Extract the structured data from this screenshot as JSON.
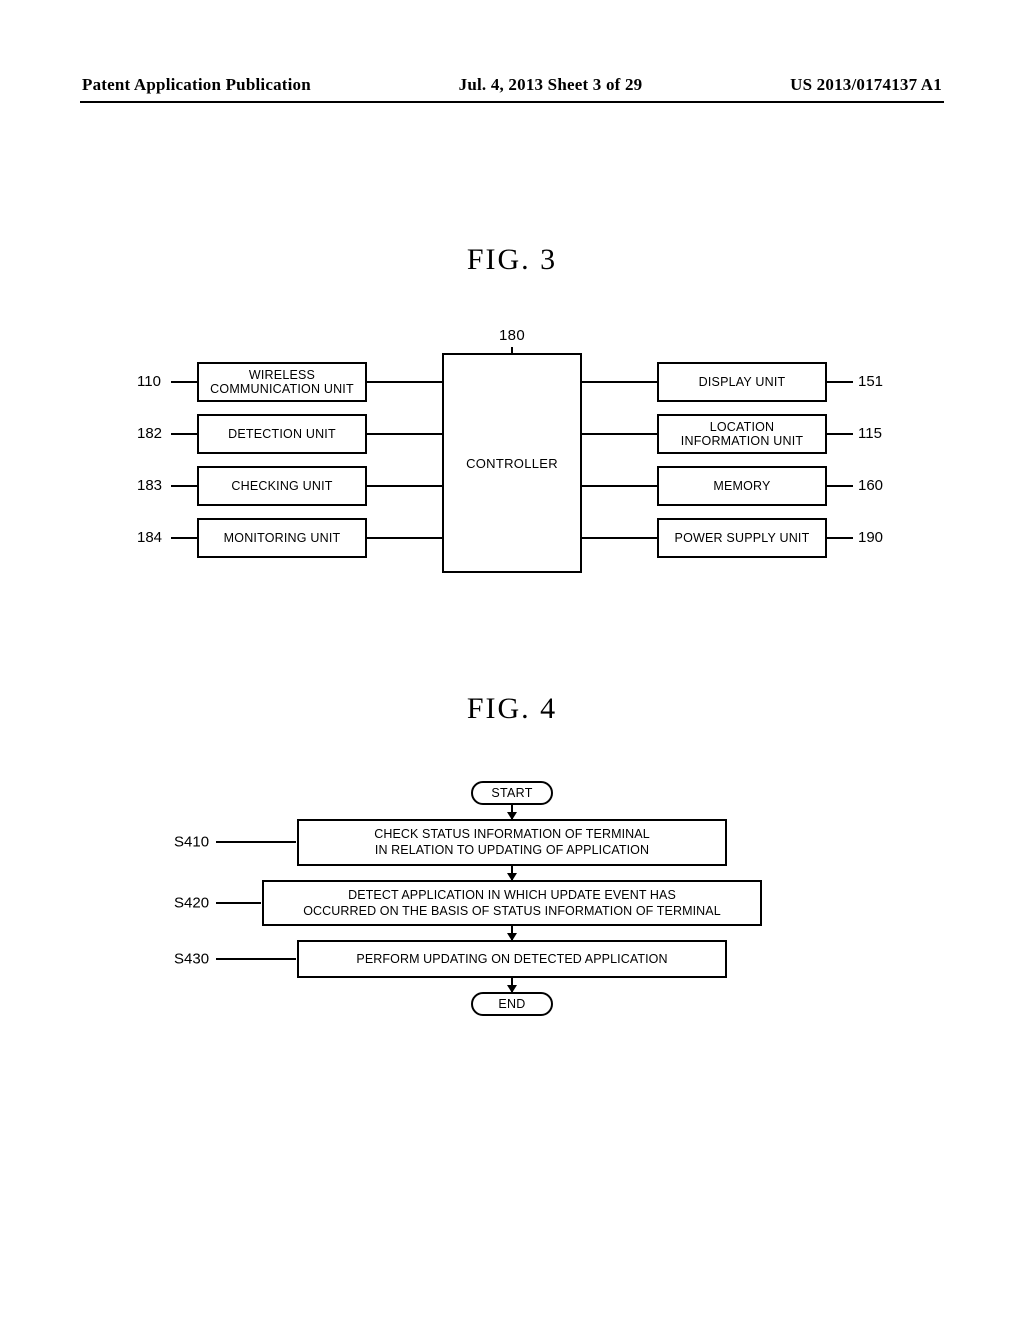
{
  "header": {
    "left": "Patent Application Publication",
    "mid": "Jul. 4, 2013  Sheet 3 of 29",
    "right": "US 2013/0174137 A1"
  },
  "fig3": {
    "title": "FIG. 3",
    "controller_ref": "180",
    "controller_label": "CONTROLLER",
    "left": [
      {
        "ref": "110",
        "label": "WIRELESS\nCOMMUNICATION UNIT"
      },
      {
        "ref": "182",
        "label": "DETECTION UNIT"
      },
      {
        "ref": "183",
        "label": "CHECKING UNIT"
      },
      {
        "ref": "184",
        "label": "MONITORING UNIT"
      }
    ],
    "right": [
      {
        "ref": "151",
        "label": "DISPLAY UNIT"
      },
      {
        "ref": "115",
        "label": "LOCATION\nINFORMATION UNIT"
      },
      {
        "ref": "160",
        "label": "MEMORY"
      },
      {
        "ref": "190",
        "label": "POWER SUPPLY UNIT"
      }
    ]
  },
  "fig4": {
    "title": "FIG. 4",
    "start": "START",
    "end": "END",
    "steps": [
      {
        "ref": "S410",
        "label": "CHECK STATUS INFORMATION OF TERMINAL\nIN RELATION TO UPDATING OF APPLICATION"
      },
      {
        "ref": "S420",
        "label": "DETECT APPLICATION IN WHICH UPDATE EVENT HAS\nOCCURRED ON THE BASIS OF STATUS INFORMATION OF TERMINAL"
      },
      {
        "ref": "S430",
        "label": "PERFORM UPDATING ON DETECTED APPLICATION"
      }
    ]
  }
}
